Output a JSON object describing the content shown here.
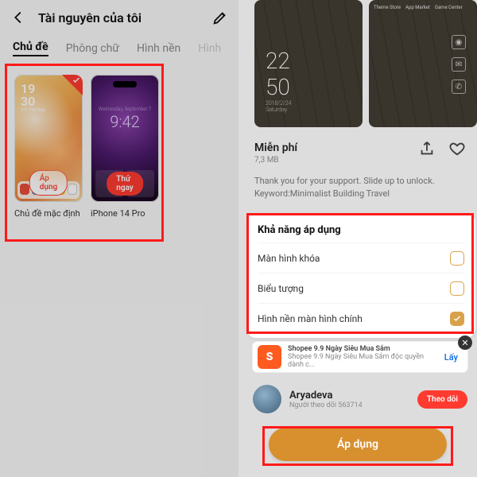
{
  "left": {
    "title": "Tài nguyên của tôi",
    "tabs": [
      "Chủ đề",
      "Phông chữ",
      "Hình nền",
      "Hình"
    ],
    "themes": [
      {
        "label": "Chủ đề mặc định",
        "clock_time": "19\n30",
        "clock_meta": "2-9 Thứ bảy",
        "cta": "Áp dụng"
      },
      {
        "label": "iPhone 14 Pro",
        "clock_meta": "Wednesday, September 7",
        "clock_time": "9:42",
        "cta": "Thử ngay"
      }
    ]
  },
  "right": {
    "preview": {
      "clock_hh": "22",
      "clock_mm": "50",
      "clock_date": "2018/2/24",
      "clock_day": "Saturday",
      "top_labels": [
        "Theme Store",
        "App Market",
        "Game Center"
      ]
    },
    "price_label": "Miễn phí",
    "size_label": "7,3 MB",
    "description_line1": "Thank you for your support. Slide up to unlock.",
    "description_line2": "Keyword:Minimalist Building Travel",
    "apply_panel": {
      "title": "Khả năng áp dụng",
      "rows": [
        {
          "label": "Màn hình khóa",
          "checked": false
        },
        {
          "label": "Biểu tượng",
          "checked": false
        },
        {
          "label": "Hình nền màn hình chính",
          "checked": true
        }
      ]
    },
    "ad": {
      "logo": "S",
      "text_line1": "Shopee 9.9 Ngày Siêu Mua Sắm",
      "text_line2": "Shopee 9.9 Ngày Siêu Mua Sắm độc quyền dành c...",
      "get": "Lấy"
    },
    "user": {
      "name": "Aryadeva",
      "meta": "Người theo dõi 563714",
      "follow": "Theo dõi"
    },
    "apply_button": "Áp dụng"
  }
}
